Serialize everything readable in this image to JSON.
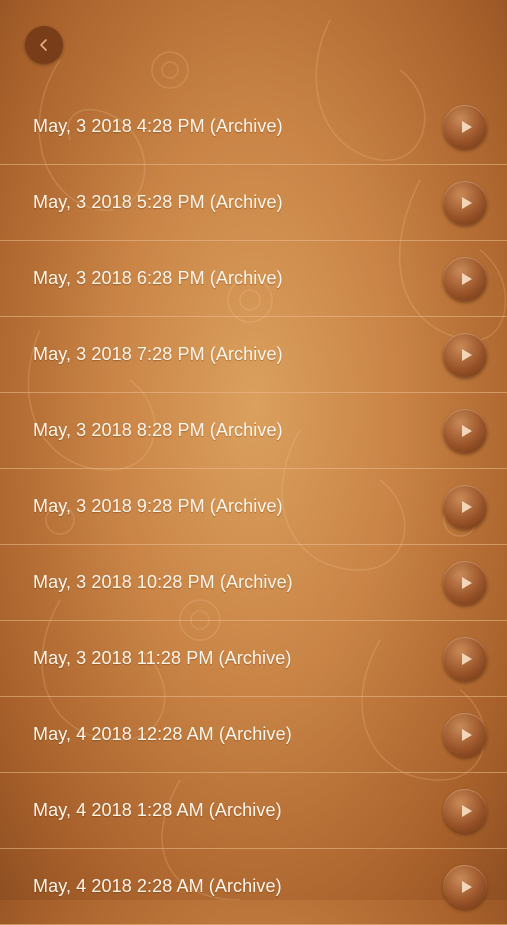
{
  "nav": {
    "back_icon": "chevron-left-icon"
  },
  "recordings": [
    {
      "label": "May, 3 2018 4:28 PM (Archive)"
    },
    {
      "label": "May, 3 2018 5:28 PM (Archive)"
    },
    {
      "label": "May, 3 2018 6:28 PM (Archive)"
    },
    {
      "label": "May, 3 2018 7:28 PM (Archive)"
    },
    {
      "label": "May, 3 2018 8:28 PM (Archive)"
    },
    {
      "label": "May, 3 2018 9:28 PM (Archive)"
    },
    {
      "label": "May, 3 2018 10:28 PM (Archive)"
    },
    {
      "label": "May, 3 2018 11:28 PM (Archive)"
    },
    {
      "label": "May, 4 2018 12:28 AM (Archive)"
    },
    {
      "label": "May, 4 2018 1:28 AM (Archive)"
    },
    {
      "label": "May, 4 2018 2:28 AM (Archive)"
    }
  ],
  "colors": {
    "background": "#c98446",
    "back_button": "#7a3d1a",
    "play_button": "#9a5429",
    "text": "#fff6ea",
    "divider": "#f0be8c"
  }
}
